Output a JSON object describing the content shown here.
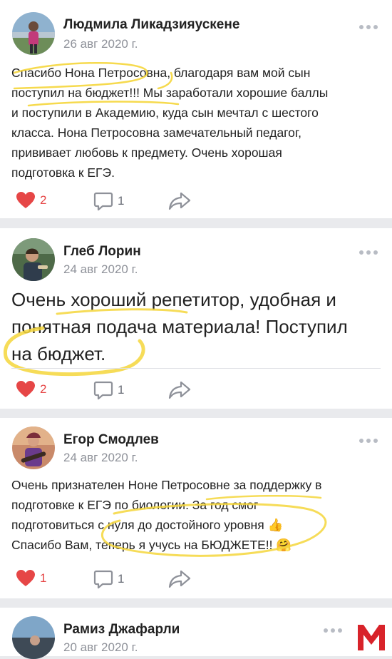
{
  "posts": [
    {
      "author": "Людмила Ликадзияускене",
      "date": "26 авг 2020 г.",
      "lines": [
        "Спасибо Нона Петросовна, благодаря вам мой сын",
        "поступил на бюджет!!! Мы заработали хорошие баллы",
        "и поступили в Академию,  куда  сын мечтал с шестого",
        "класса. Нона Петросовна  замечательный педагог,",
        "прививает любовь к предмету. Очень хорошая",
        "подготовка к ЕГЭ."
      ],
      "likes": "2",
      "comments": "1",
      "liked": true
    },
    {
      "author": "Глеб Лорин",
      "date": "24 авг 2020 г.",
      "lines": [
        "Очень хороший репетитор, удобная и",
        "понятная подача материала! Поступил",
        "на бюджет."
      ],
      "likes": "2",
      "comments": "1",
      "liked": true
    },
    {
      "author": "Егор Смодлев",
      "date": "24 авг 2020 г.",
      "lines": [
        "Очень признателен Ноне Петросовне за поддержку в",
        "подготовке к ЕГЭ по биологии. За год смог",
        "подготовиться с нуля до достойного уровня 👍",
        "Спасибо Вам, теперь я учусь на БЮДЖЕТЕ!! 🤗"
      ],
      "likes": "1",
      "comments": "1",
      "liked": true
    },
    {
      "author": "Рамиз Джафарли",
      "date": "20 авг 2020 г."
    }
  ],
  "icons": {
    "like": "heart-icon",
    "comment": "comment-icon",
    "share": "share-icon",
    "more": "more-dots-icon"
  },
  "colors": {
    "like": "#e64646",
    "highlight": "#f5d63b",
    "muted": "#8e9199",
    "logo": "#d8232a"
  }
}
